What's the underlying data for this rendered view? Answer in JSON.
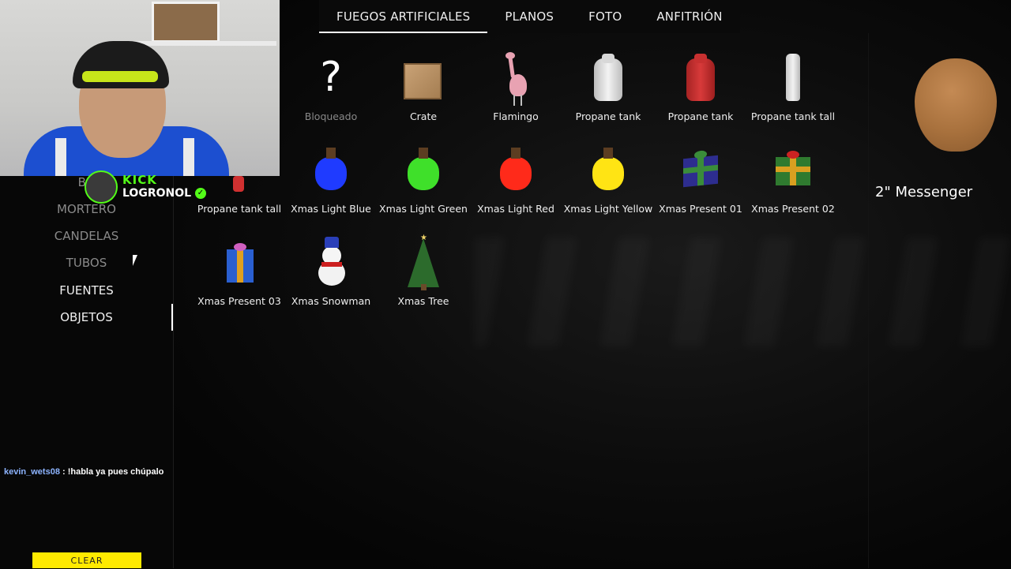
{
  "tabs": [
    {
      "label": "FUEGOS ARTIFICIALES",
      "active": true
    },
    {
      "label": "PLANOS"
    },
    {
      "label": "FOTO"
    },
    {
      "label": "ANFITRIÓN"
    }
  ],
  "categories": [
    {
      "label": "BO"
    },
    {
      "label": "MORTERO"
    },
    {
      "label": "CANDELAS"
    },
    {
      "label": "TUBOS"
    },
    {
      "label": "FUENTES"
    },
    {
      "label": "OBJETOS",
      "active": true
    }
  ],
  "overlay": {
    "platform": "KICK",
    "streamer": "LOGRONOL",
    "verified_icon": "verified-check-icon"
  },
  "items": [
    {
      "label": "Bloqueado",
      "icon": "question-mark-icon",
      "locked": true
    },
    {
      "label": "Crate",
      "icon": "crate-icon"
    },
    {
      "label": "Flamingo",
      "icon": "flamingo-icon"
    },
    {
      "label": "Propane tank",
      "icon": "propane-tank-white-icon"
    },
    {
      "label": "Propane tank",
      "icon": "propane-tank-red-icon"
    },
    {
      "label": "Propane tank tall",
      "icon": "propane-tank-tall-icon"
    },
    {
      "label": "Propane tank tall",
      "icon": "propane-tank-tall-red-icon"
    },
    {
      "label": "Xmas Light Blue",
      "icon": "xmas-light-blue-icon",
      "color": "#1f3bff"
    },
    {
      "label": "Xmas Light Green",
      "icon": "xmas-light-green-icon",
      "color": "#3fe02a"
    },
    {
      "label": "Xmas Light Red",
      "icon": "xmas-light-red-icon",
      "color": "#ff2a1a"
    },
    {
      "label": "Xmas Light Yellow",
      "icon": "xmas-light-yellow-icon",
      "color": "#ffe414"
    },
    {
      "label": "Xmas Present 01",
      "icon": "xmas-present-01-icon"
    },
    {
      "label": "Xmas Present 02",
      "icon": "xmas-present-02-icon"
    },
    {
      "label": "Xmas Present 03",
      "icon": "xmas-present-03-icon"
    },
    {
      "label": "Xmas Snowman",
      "icon": "snowman-icon"
    },
    {
      "label": "Xmas Tree",
      "icon": "xmas-tree-icon"
    }
  ],
  "preview": {
    "name": "2\" Messenger",
    "icon": "messenger-shell-icon"
  },
  "chat": {
    "user": "kevin_wets08",
    "message": " : !habla ya pues chúpalo"
  },
  "clear_label": "CLEAR",
  "colors": {
    "kick_green": "#53fc18",
    "clear_yellow": "#ffea00",
    "accent_white": "#ffffff"
  }
}
